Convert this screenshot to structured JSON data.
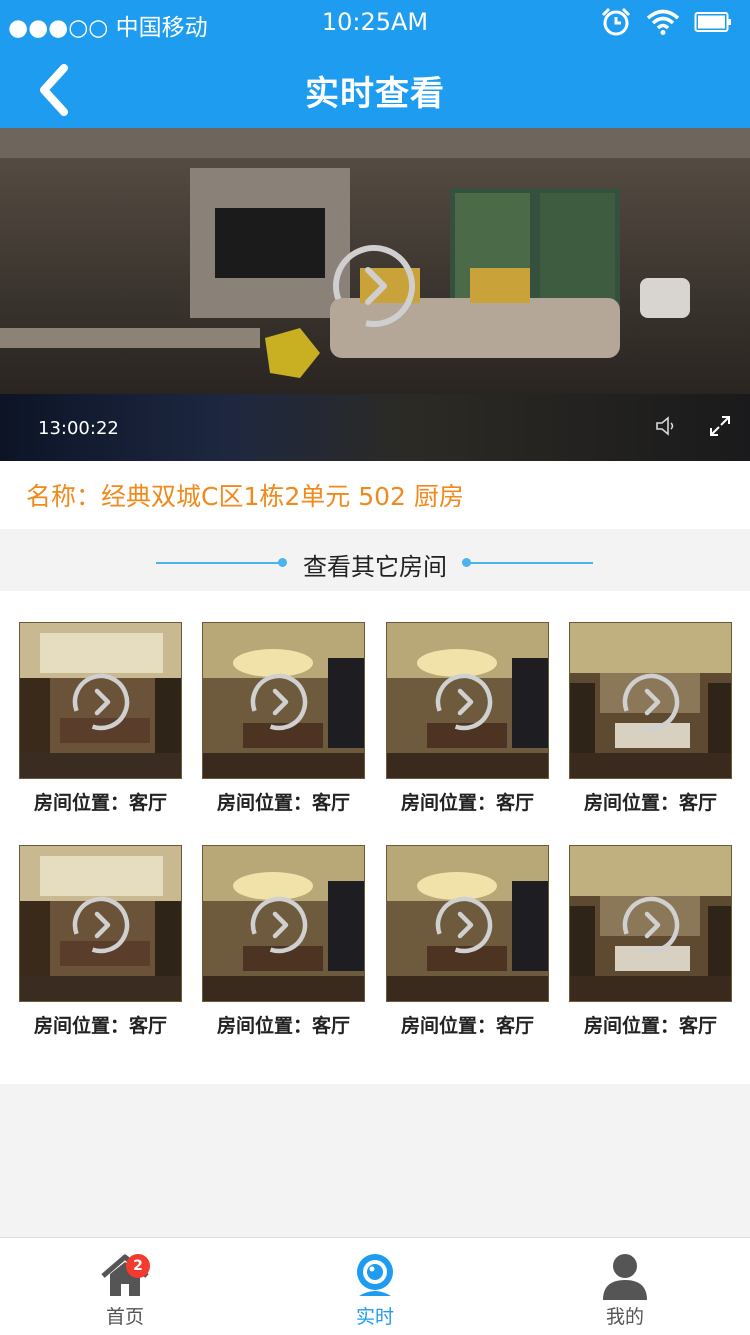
{
  "status_bar": {
    "carrier": "●●●○○ 中国移动",
    "time": "10:25AM"
  },
  "header": {
    "title": "实时查看",
    "back_icon": "chevron-left-icon"
  },
  "video": {
    "timecode": "13:00:22",
    "play_icon": "play-circle-icon",
    "volume_icon": "speaker-icon",
    "fullscreen_icon": "fullscreen-icon"
  },
  "device": {
    "name": "名称：经典双城C区1栋2单元 502 厨房"
  },
  "section": {
    "title": "查看其它房间"
  },
  "rooms": [
    {
      "label": "房间位置：客厅"
    },
    {
      "label": "房间位置：客厅"
    },
    {
      "label": "房间位置：客厅"
    },
    {
      "label": "房间位置：客厅"
    },
    {
      "label": "房间位置：客厅"
    },
    {
      "label": "房间位置：客厅"
    },
    {
      "label": "房间位置：客厅"
    },
    {
      "label": "房间位置：客厅"
    }
  ],
  "tabbar": {
    "items": [
      {
        "label": "首页",
        "icon": "home-icon",
        "badge": "2"
      },
      {
        "label": "实时",
        "icon": "camera-icon"
      },
      {
        "label": "我的",
        "icon": "user-icon"
      }
    ]
  },
  "colors": {
    "primary": "#1d9cf0",
    "accent_orange": "#f08a1c",
    "badge_red": "#f23b2e"
  }
}
